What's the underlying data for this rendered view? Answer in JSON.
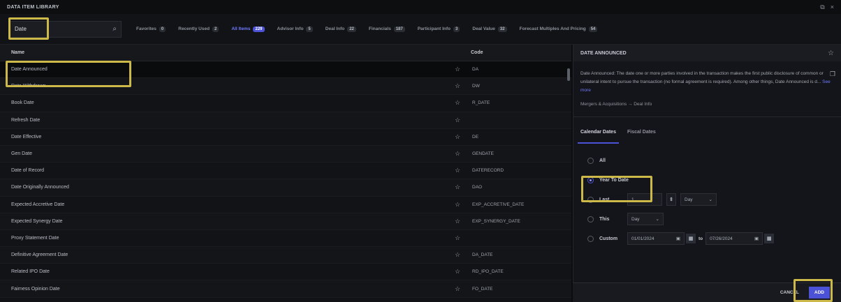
{
  "window": {
    "title": "DATA ITEM LIBRARY",
    "controls": [
      "⧉",
      "×"
    ]
  },
  "search": {
    "value": "Date",
    "placeholder": ""
  },
  "tabs": [
    {
      "label": "Favorites",
      "count": "0"
    },
    {
      "label": "Recently Used",
      "count": "2"
    },
    {
      "label": "All Items",
      "count": "229",
      "active": true
    },
    {
      "label": "Advisor Info",
      "count": "5"
    },
    {
      "label": "Deal Info",
      "count": "22"
    },
    {
      "label": "Financials",
      "count": "187"
    },
    {
      "label": "Participant Info",
      "count": "3"
    },
    {
      "label": "Deal Value",
      "count": "32"
    },
    {
      "label": "Forecast Multiples And Pricing",
      "count": "54"
    }
  ],
  "table": {
    "headers": {
      "name": "Name",
      "code": "Code"
    },
    "rows": [
      {
        "name": "Date Announced",
        "code": "DA"
      },
      {
        "name": "Date Withdrawn",
        "code": "DW"
      },
      {
        "name": "Book Date",
        "code": "R_DATE"
      },
      {
        "name": "Refresh Date",
        "code": ""
      },
      {
        "name": "Date Effective",
        "code": "DE"
      },
      {
        "name": "Gen Date",
        "code": "GENDATE"
      },
      {
        "name": "Date of Record",
        "code": "DATERECORD"
      },
      {
        "name": "Date Originally Announced",
        "code": "DAO"
      },
      {
        "name": "Expected Accretive Date",
        "code": "EXP_ACCRETIVE_DATE"
      },
      {
        "name": "Expected Synergy Date",
        "code": "EXP_SYNERGY_DATE"
      },
      {
        "name": "Proxy Statement Date",
        "code": ""
      },
      {
        "name": "Definitive Agreement Date",
        "code": "DA_DATE"
      },
      {
        "name": "Related IPO Date",
        "code": "RD_IPO_DATE"
      },
      {
        "name": "Fairness Opinion Date",
        "code": "FO_DATE"
      }
    ]
  },
  "detail": {
    "title": "DATE ANNOUNCED",
    "description": "Date Announced: The date one or more parties involved in the transaction makes the first public disclosure of common or unilateral intent to pursue the transaction (no formal agreement is required). Among other things, Date Announced is d...",
    "see_more": "See more",
    "breadcrumb": "Mergers & Acquisitions → Deal Info",
    "tabs": {
      "calendar": "Calendar Dates",
      "fiscal": "Fiscal Dates"
    },
    "options": {
      "all": "All",
      "ytd": "Year To Date",
      "last": "Last",
      "last_value": "1",
      "last_unit": "Day",
      "this": "This",
      "this_unit": "Day",
      "custom": "Custom",
      "from": "01/01/2024",
      "to_label": "to",
      "to": "07/26/2024"
    },
    "buttons": {
      "cancel": "CANCEL",
      "add": "ADD"
    }
  }
}
